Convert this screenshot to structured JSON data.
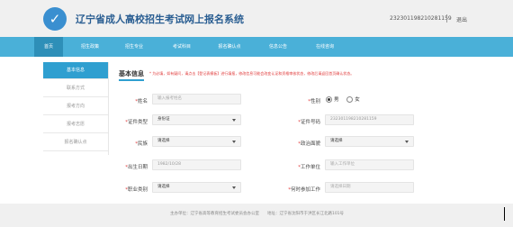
{
  "header": {
    "logo_glyph": "✓",
    "title": "辽宁省成人高校招生考试网上报名系统",
    "user_id": "232301198210281159",
    "logout_label": "退出"
  },
  "nav": {
    "items": [
      {
        "label": "首页",
        "active": true
      },
      {
        "label": "招生政策",
        "active": false
      },
      {
        "label": "招生专业",
        "active": false
      },
      {
        "label": "考试科目",
        "active": false
      },
      {
        "label": "报名确认点",
        "active": false
      },
      {
        "label": "信息公告",
        "active": false
      },
      {
        "label": "在线咨询",
        "active": false
      }
    ]
  },
  "sidebar": {
    "items": [
      {
        "label": "基本信息",
        "active": true
      },
      {
        "label": "联系方式",
        "active": false
      },
      {
        "label": "报考方向",
        "active": false
      },
      {
        "label": "报考志愿",
        "active": false
      },
      {
        "label": "报名确认点",
        "active": false
      }
    ]
  },
  "form": {
    "section_title": "基本信息",
    "notice": "* 为必填，如有疑问，请点击【登记表模板】进行填报，修改信息可能会改变认证和资格审核状态，修改后请返回首页确认状态。",
    "required_mark": "*",
    "name_label": "姓名",
    "name_placeholder": "输入报考姓名",
    "gender_label": "性别",
    "gender_options": [
      "男",
      "女"
    ],
    "gender_selected": "男",
    "id_type_label": "证件类型",
    "id_type_value": "身份证",
    "id_number_label": "证件号码",
    "id_number_value": "232301198210281159",
    "ethnicity_label": "民族",
    "ethnicity_value": "请选择",
    "political_label": "政治面貌",
    "political_value": "请选择",
    "birth_label": "出生日期",
    "birth_value": "1982/10/28",
    "workplace_label": "工作单位",
    "workplace_placeholder": "输入工作单位",
    "occupation_label": "职业类别",
    "occupation_value": "请选择",
    "work_start_label": "何时参加工作",
    "work_start_placeholder": "请选择日期"
  },
  "footer": {
    "text": "主办单位：辽宁省高等教育招生考试委员会办公室　　地址：辽宁省沈阳市于洪区长江北路101号"
  },
  "colors": {
    "nav_bg": "#4ab0d8",
    "nav_active": "#2e8fb8",
    "accent": "#2f9fd0",
    "title": "#2a5e92",
    "required": "#e03c3c"
  }
}
